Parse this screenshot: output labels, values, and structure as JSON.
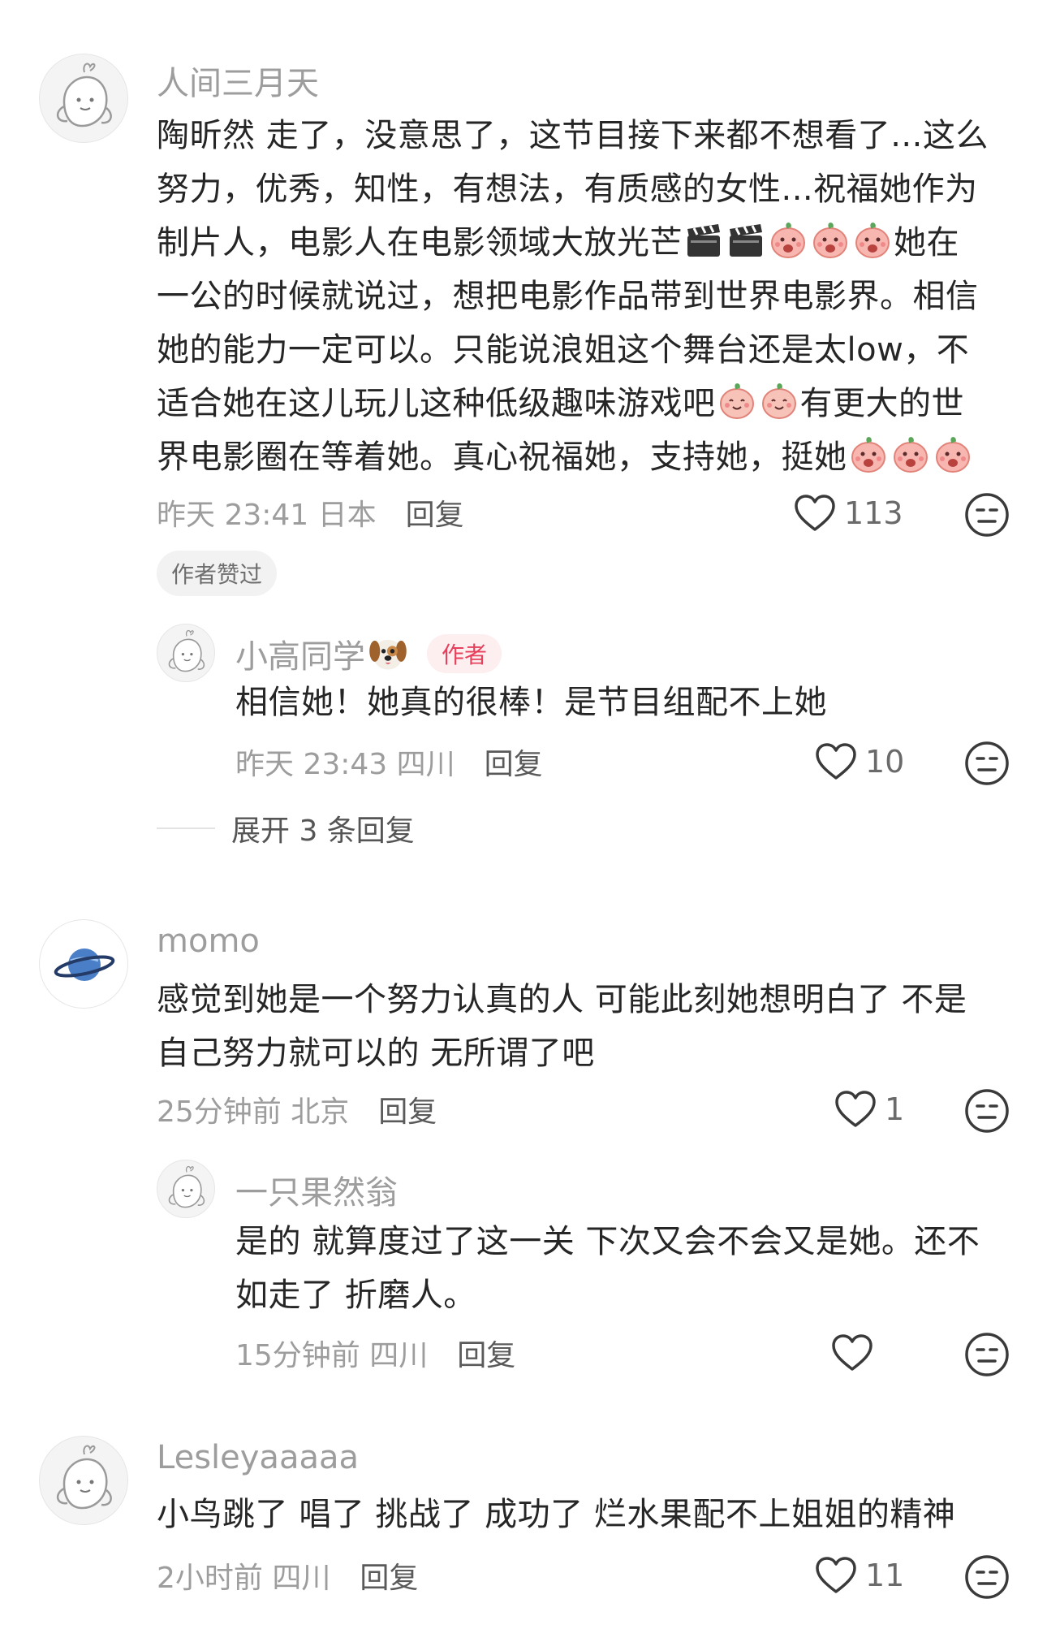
{
  "comments": [
    {
      "username": "人间三月天",
      "lines": [
        "陶昕然 走了，没意思了，这节目接下来都不想看了...这么",
        "努力，优秀，知性，有想法，有质感的女性...祝福她作为",
        "制片人，电影人在电影领域大放光芒",
        "一公的时候就说过，想把电影作品带到世界电影界。相信",
        "她的能力一定可以。只能说浪姐这个舞台还是太low，不",
        "适合她在这儿玩儿这种低级趣味游戏吧",
        "界电影圈在等着她。真心祝福她，支持她，挺她"
      ],
      "line3_tail": "她在",
      "line6_tail": "有更大的世",
      "time": "昨天 23:41 日本",
      "reply_label": "回复",
      "likes": "113",
      "badge": "作者赞过",
      "reply": {
        "username": "小高同学",
        "author_tag": "作者",
        "text": "相信她！她真的很棒！是节目组配不上她",
        "time": "昨天 23:43 四川",
        "reply_label": "回复",
        "likes": "10"
      },
      "expand_label": "展开 3 条回复"
    },
    {
      "username": "momo",
      "lines": [
        "感觉到她是一个努力认真的人 可能此刻她想明白了 不是",
        "自己努力就可以的 无所谓了吧"
      ],
      "time": "25分钟前 北京",
      "reply_label": "回复",
      "likes": "1",
      "reply": {
        "username": "一只果然翁",
        "lines": [
          "是的 就算度过了这一关 下次又会不会又是她。还不",
          "如走了 折磨人。"
        ],
        "time": "15分钟前 四川",
        "reply_label": "回复",
        "likes": ""
      }
    },
    {
      "username": "Lesleyaaaaa",
      "lines": [
        "小鸟跳了 唱了 挑战了 成功了 烂水果配不上姐姐的精神"
      ],
      "time": "2小时前 四川",
      "reply_label": "回复",
      "likes": "11"
    }
  ],
  "icons": {
    "like": "heart-outline-icon",
    "dislike": "neutral-face-icon",
    "emoji_clapper": "clapperboard-emoji",
    "emoji_shout": "peach-shout-emoji",
    "emoji_smile": "peach-smile-emoji",
    "emoji_dog": "dog-emoji"
  }
}
